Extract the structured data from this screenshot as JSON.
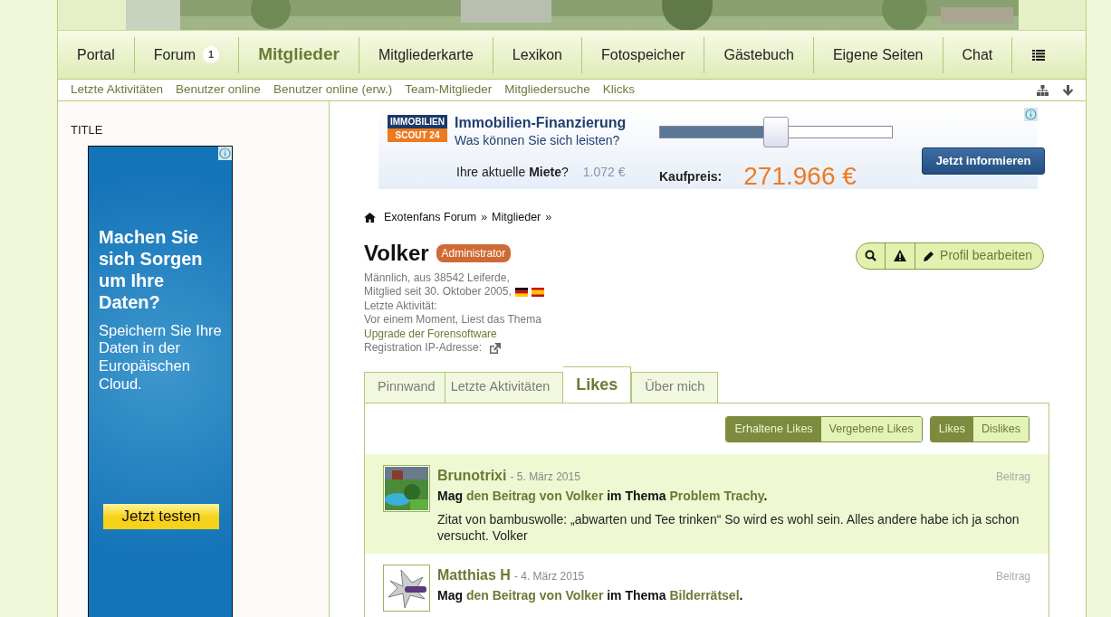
{
  "nav": {
    "items": [
      {
        "label": "Portal",
        "selected": false
      },
      {
        "label": "Forum",
        "badge": "1",
        "selected": false
      },
      {
        "label": "Mitglieder",
        "selected": true
      },
      {
        "label": "Mitgliederkarte",
        "selected": false
      },
      {
        "label": "Lexikon",
        "selected": false
      },
      {
        "label": "Fotospeicher",
        "selected": false
      },
      {
        "label": "Gästebuch",
        "selected": false
      },
      {
        "label": "Eigene Seiten",
        "selected": false
      },
      {
        "label": "Chat",
        "selected": false
      }
    ]
  },
  "subnav": {
    "items": [
      "Letzte Aktivitäten",
      "Benutzer online",
      "Benutzer online (erw.)",
      "Team-Mitglieder",
      "Mitgliedersuche",
      "Klicks"
    ]
  },
  "sidebar": {
    "title": "TITLE",
    "ad": {
      "headline": "Machen Sie sich Sorgen um Ihre Daten?",
      "body": "Speichern Sie Ihre Daten in der Europäischen Cloud.",
      "button": "Jetzt testen"
    }
  },
  "banner": {
    "logo_top": "IMMOBILIEN",
    "logo_bottom": "SCOUT 24",
    "title": "Immobilien-Finanzierung",
    "subtitle": "Was können Sie sich leisten?",
    "slider": {
      "level": 0.5
    },
    "rent_label": "Ihre aktuelle **Miete**?",
    "rent_value": "1.072 €",
    "price_label": "Kaufpreis:",
    "price": "271.966 €",
    "button": "Jetzt informieren"
  },
  "breadcrumbs": {
    "items": [
      "Exotenfans Forum",
      "Mitglieder"
    ],
    "separator": "»"
  },
  "profile": {
    "name": "Volker",
    "role": "Administrator",
    "gender_location": "Männlich, aus 38542 Leiferde,",
    "member_since": "Mitglied seit 30. Oktober 2005,",
    "activity_label": "Letzte Aktivität:",
    "activity_text": "Vor einem Moment, Liest das Thema",
    "activity_link": "Upgrade der Forensoftware",
    "ip_label": "Registration IP-Adresse:",
    "edit_button": "Profil bearbeiten"
  },
  "tabs": [
    {
      "label": "Pinnwand",
      "selected": false
    },
    {
      "label": "Letzte Aktivitäten",
      "selected": false
    },
    {
      "label": "Likes",
      "selected": true
    },
    {
      "label": "Über mich",
      "selected": false
    }
  ],
  "filters": [
    [
      {
        "label": "Erhaltene Likes",
        "selected": true
      },
      {
        "label": "Vergebene Likes",
        "selected": false
      }
    ],
    [
      {
        "label": "Likes",
        "selected": true
      },
      {
        "label": "Dislikes",
        "selected": false
      }
    ]
  ],
  "likes": [
    {
      "user": "Brunotrixi",
      "date": "- 5. März 2015",
      "type": "Beitrag",
      "verb": "Mag",
      "object": "den Beitrag von Volker",
      "in": "im Thema",
      "topic": "Problem Trachy",
      "end": ".",
      "excerpt": "Zitat von bambuswolle: „abwarten und Tee trinken“ So wird es wohl sein. Alles andere habe ich ja schon versucht. Volker"
    },
    {
      "user": "Matthias H",
      "date": "- 4. März 2015",
      "type": "Beitrag",
      "verb": "Mag",
      "object": "den Beitrag von Volker",
      "in": "im Thema",
      "topic": "Bilderrätsel",
      "end": "."
    }
  ]
}
